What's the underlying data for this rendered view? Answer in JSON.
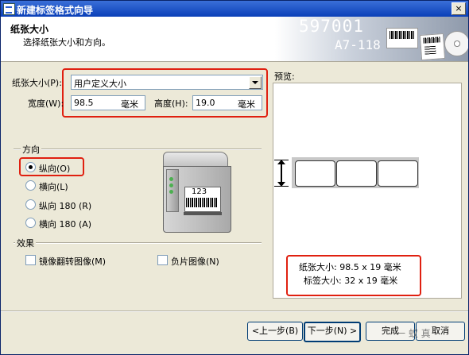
{
  "window": {
    "title": "新建标签格式向导",
    "close_glyph": "×"
  },
  "header": {
    "title": "纸张大小",
    "subtitle": "选择纸张大小和方向。",
    "banner_number": "597001",
    "banner_code": "A7-118"
  },
  "paper": {
    "size_label": "纸张大小(P):",
    "size_value": "用户定义大小",
    "width_label": "宽度(W):",
    "width_value": "98.5",
    "width_unit": "毫米",
    "height_label": "高度(H):",
    "height_value": "19.0",
    "height_unit": "毫米"
  },
  "orientation": {
    "group_label": "方向",
    "options": [
      {
        "label": "纵向(O)",
        "selected": true
      },
      {
        "label": "横向(L)",
        "selected": false
      },
      {
        "label": "纵向 180 (R)",
        "selected": false
      },
      {
        "label": "横向 180 (A)",
        "selected": false
      }
    ]
  },
  "printer": {
    "screen_number": "123"
  },
  "effects": {
    "group_label": "效果",
    "mirror_label": "镜像翻转图像(M)",
    "negative_label": "负片图像(N)"
  },
  "preview": {
    "label": "预览:",
    "paper_size_text": "纸张大小: 98.5 x 19 毫米",
    "label_size_text": "标签大小: 32 x 19 毫米"
  },
  "buttons": {
    "back": "<上一步(B)",
    "next": "下一步(N) >",
    "finish": "完成",
    "cancel": "取消"
  },
  "watermark": "一 蚁 真",
  "colors": {
    "highlight": "#e02010",
    "title_bar": "#0a3fb8",
    "dialog_bg": "#ece9d8"
  }
}
